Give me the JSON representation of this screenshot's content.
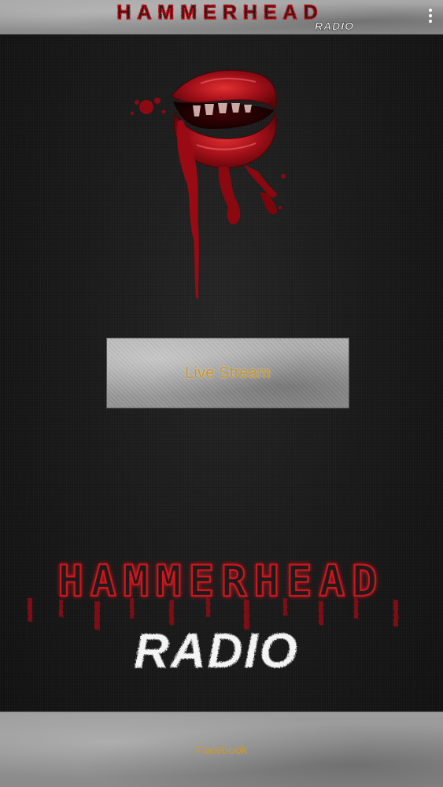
{
  "header": {
    "logo_title": "HAMMERHEAD",
    "logo_subtitle": "RADIO",
    "menu_icon": "more-vert-icon"
  },
  "artwork": {
    "icon": "bloody-lips-icon"
  },
  "main": {
    "live_stream_label": "Live Stream"
  },
  "logo": {
    "title": "HAMMERHEAD",
    "subtitle": "RADIO"
  },
  "footer": {
    "facebook_label": "Facebook"
  },
  "colors": {
    "logo_red": "#b01018",
    "button_text": "#c8952b",
    "background": "#1b1b1b"
  }
}
